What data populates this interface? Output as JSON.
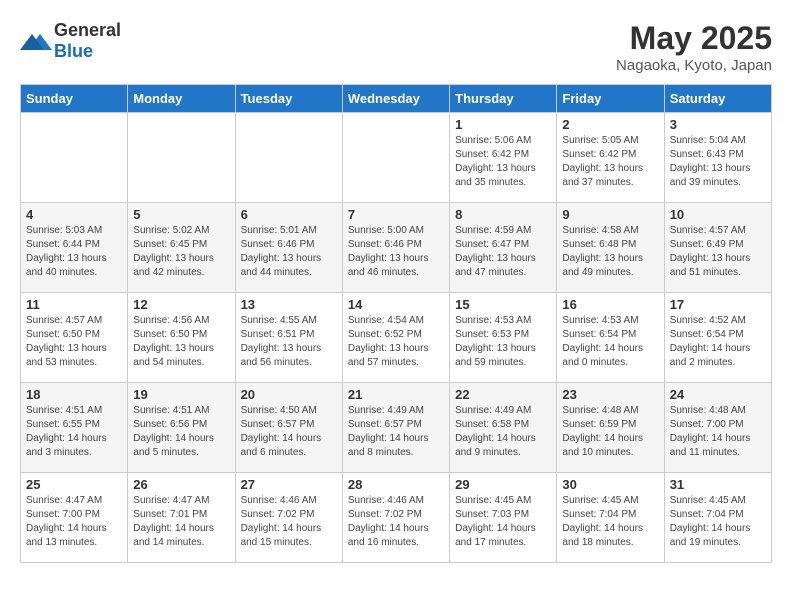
{
  "header": {
    "logo_general": "General",
    "logo_blue": "Blue",
    "month_year": "May 2025",
    "location": "Nagaoka, Kyoto, Japan"
  },
  "weekdays": [
    "Sunday",
    "Monday",
    "Tuesday",
    "Wednesday",
    "Thursday",
    "Friday",
    "Saturday"
  ],
  "weeks": [
    [
      {
        "day": "",
        "info": ""
      },
      {
        "day": "",
        "info": ""
      },
      {
        "day": "",
        "info": ""
      },
      {
        "day": "",
        "info": ""
      },
      {
        "day": "1",
        "info": "Sunrise: 5:06 AM\nSunset: 6:42 PM\nDaylight: 13 hours\nand 35 minutes."
      },
      {
        "day": "2",
        "info": "Sunrise: 5:05 AM\nSunset: 6:42 PM\nDaylight: 13 hours\nand 37 minutes."
      },
      {
        "day": "3",
        "info": "Sunrise: 5:04 AM\nSunset: 6:43 PM\nDaylight: 13 hours\nand 39 minutes."
      }
    ],
    [
      {
        "day": "4",
        "info": "Sunrise: 5:03 AM\nSunset: 6:44 PM\nDaylight: 13 hours\nand 40 minutes."
      },
      {
        "day": "5",
        "info": "Sunrise: 5:02 AM\nSunset: 6:45 PM\nDaylight: 13 hours\nand 42 minutes."
      },
      {
        "day": "6",
        "info": "Sunrise: 5:01 AM\nSunset: 6:46 PM\nDaylight: 13 hours\nand 44 minutes."
      },
      {
        "day": "7",
        "info": "Sunrise: 5:00 AM\nSunset: 6:46 PM\nDaylight: 13 hours\nand 46 minutes."
      },
      {
        "day": "8",
        "info": "Sunrise: 4:59 AM\nSunset: 6:47 PM\nDaylight: 13 hours\nand 47 minutes."
      },
      {
        "day": "9",
        "info": "Sunrise: 4:58 AM\nSunset: 6:48 PM\nDaylight: 13 hours\nand 49 minutes."
      },
      {
        "day": "10",
        "info": "Sunrise: 4:57 AM\nSunset: 6:49 PM\nDaylight: 13 hours\nand 51 minutes."
      }
    ],
    [
      {
        "day": "11",
        "info": "Sunrise: 4:57 AM\nSunset: 6:50 PM\nDaylight: 13 hours\nand 53 minutes."
      },
      {
        "day": "12",
        "info": "Sunrise: 4:56 AM\nSunset: 6:50 PM\nDaylight: 13 hours\nand 54 minutes."
      },
      {
        "day": "13",
        "info": "Sunrise: 4:55 AM\nSunset: 6:51 PM\nDaylight: 13 hours\nand 56 minutes."
      },
      {
        "day": "14",
        "info": "Sunrise: 4:54 AM\nSunset: 6:52 PM\nDaylight: 13 hours\nand 57 minutes."
      },
      {
        "day": "15",
        "info": "Sunrise: 4:53 AM\nSunset: 6:53 PM\nDaylight: 13 hours\nand 59 minutes."
      },
      {
        "day": "16",
        "info": "Sunrise: 4:53 AM\nSunset: 6:54 PM\nDaylight: 14 hours\nand 0 minutes."
      },
      {
        "day": "17",
        "info": "Sunrise: 4:52 AM\nSunset: 6:54 PM\nDaylight: 14 hours\nand 2 minutes."
      }
    ],
    [
      {
        "day": "18",
        "info": "Sunrise: 4:51 AM\nSunset: 6:55 PM\nDaylight: 14 hours\nand 3 minutes."
      },
      {
        "day": "19",
        "info": "Sunrise: 4:51 AM\nSunset: 6:56 PM\nDaylight: 14 hours\nand 5 minutes."
      },
      {
        "day": "20",
        "info": "Sunrise: 4:50 AM\nSunset: 6:57 PM\nDaylight: 14 hours\nand 6 minutes."
      },
      {
        "day": "21",
        "info": "Sunrise: 4:49 AM\nSunset: 6:57 PM\nDaylight: 14 hours\nand 8 minutes."
      },
      {
        "day": "22",
        "info": "Sunrise: 4:49 AM\nSunset: 6:58 PM\nDaylight: 14 hours\nand 9 minutes."
      },
      {
        "day": "23",
        "info": "Sunrise: 4:48 AM\nSunset: 6:59 PM\nDaylight: 14 hours\nand 10 minutes."
      },
      {
        "day": "24",
        "info": "Sunrise: 4:48 AM\nSunset: 7:00 PM\nDaylight: 14 hours\nand 11 minutes."
      }
    ],
    [
      {
        "day": "25",
        "info": "Sunrise: 4:47 AM\nSunset: 7:00 PM\nDaylight: 14 hours\nand 13 minutes."
      },
      {
        "day": "26",
        "info": "Sunrise: 4:47 AM\nSunset: 7:01 PM\nDaylight: 14 hours\nand 14 minutes."
      },
      {
        "day": "27",
        "info": "Sunrise: 4:46 AM\nSunset: 7:02 PM\nDaylight: 14 hours\nand 15 minutes."
      },
      {
        "day": "28",
        "info": "Sunrise: 4:46 AM\nSunset: 7:02 PM\nDaylight: 14 hours\nand 16 minutes."
      },
      {
        "day": "29",
        "info": "Sunrise: 4:45 AM\nSunset: 7:03 PM\nDaylight: 14 hours\nand 17 minutes."
      },
      {
        "day": "30",
        "info": "Sunrise: 4:45 AM\nSunset: 7:04 PM\nDaylight: 14 hours\nand 18 minutes."
      },
      {
        "day": "31",
        "info": "Sunrise: 4:45 AM\nSunset: 7:04 PM\nDaylight: 14 hours\nand 19 minutes."
      }
    ]
  ]
}
